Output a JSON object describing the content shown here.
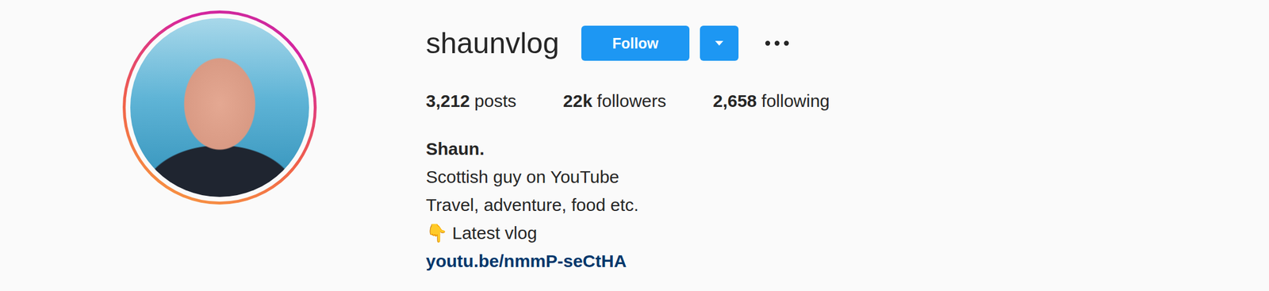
{
  "profile": {
    "username": "shaunvlog",
    "name": "Shaun.",
    "bio": [
      {
        "icon": "",
        "text": "Scottish guy on YouTube"
      },
      {
        "icon": "",
        "text": "Travel, adventure, food etc."
      },
      {
        "icon": "👇",
        "text": "Latest vlog"
      }
    ],
    "link": "youtu.be/nmmP-seCtHA"
  },
  "buttons": {
    "follow": "Follow"
  },
  "stats": [
    {
      "value": "3,212",
      "label": "posts"
    },
    {
      "value": "22k",
      "label": "followers"
    },
    {
      "value": "2,658",
      "label": "following"
    }
  ]
}
